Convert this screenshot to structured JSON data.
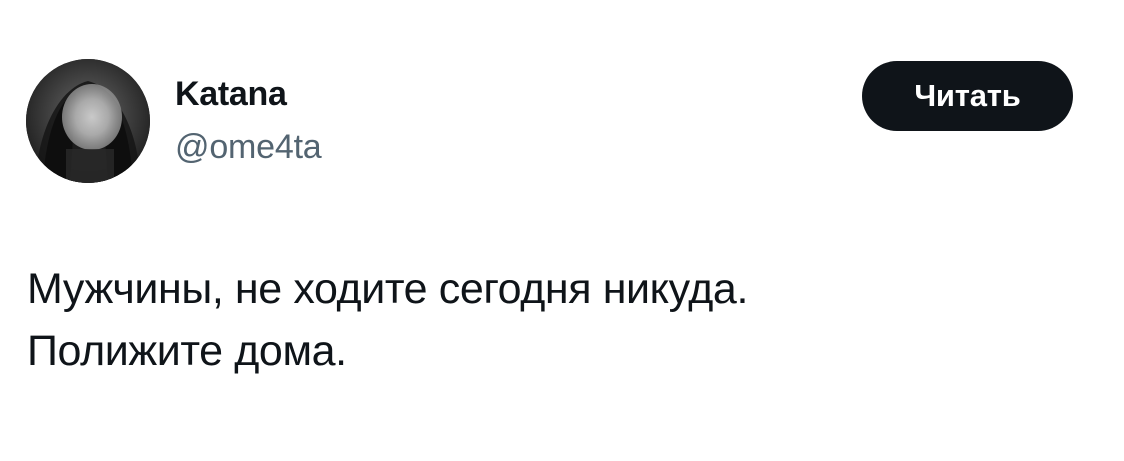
{
  "author": {
    "display_name": "Katana",
    "handle": "@ome4ta",
    "avatar_icon": "profile-photo-blurred-face"
  },
  "actions": {
    "follow_label": "Читать"
  },
  "tweet": {
    "lines": [
      "Мужчины, не ходите сегодня никуда.",
      "Полижите дома."
    ]
  },
  "colors": {
    "text_primary": "#0f1419",
    "text_secondary": "#536471",
    "button_bg": "#0f1419",
    "button_text": "#ffffff",
    "background": "#ffffff"
  }
}
